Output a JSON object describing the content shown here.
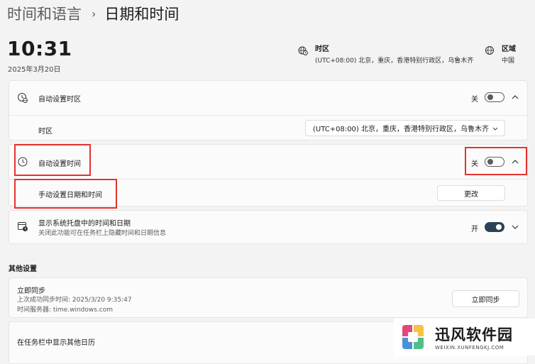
{
  "breadcrumb": {
    "parent": "时间和语言",
    "separator": "›",
    "current": "日期和时间"
  },
  "clock": {
    "time": "10:31",
    "date": "2025年3月20日"
  },
  "timezone_info": {
    "title": "时区",
    "value": "(UTC+08:00) 北京，重庆，香港特别行政区，乌鲁木齐"
  },
  "region_info": {
    "title": "区域",
    "value": "中国"
  },
  "auto_timezone": {
    "label": "自动设置时区",
    "state": "关",
    "enabled": false
  },
  "timezone_row": {
    "label": "时区",
    "selected": "(UTC+08:00) 北京，重庆，香港特别行政区，乌鲁木齐"
  },
  "auto_time": {
    "label": "自动设置时间",
    "state": "关",
    "enabled": false
  },
  "manual_time": {
    "label": "手动设置日期和时间",
    "button": "更改"
  },
  "tray_time": {
    "label": "显示系统托盘中的时间和日期",
    "sub": "关闭此功能可在任务栏上隐藏时间和日期信息",
    "state": "开",
    "enabled": true
  },
  "other_settings": {
    "title": "其他设置"
  },
  "sync": {
    "label": "立即同步",
    "last_sync": "上次成功同步时间: 2025/3/20 9:35:47",
    "server": "时间服务器: time.windows.com",
    "button": "立即同步"
  },
  "calendar": {
    "label": "在任务栏中显示其他日历"
  },
  "watermark": {
    "name": "迅风软件园",
    "url": "WEIXIN.XUNFENGKJ.COM"
  },
  "colors": {
    "highlight": "#e5322d",
    "toggle_on": "#2b4256",
    "background": "#f3f3f3"
  }
}
